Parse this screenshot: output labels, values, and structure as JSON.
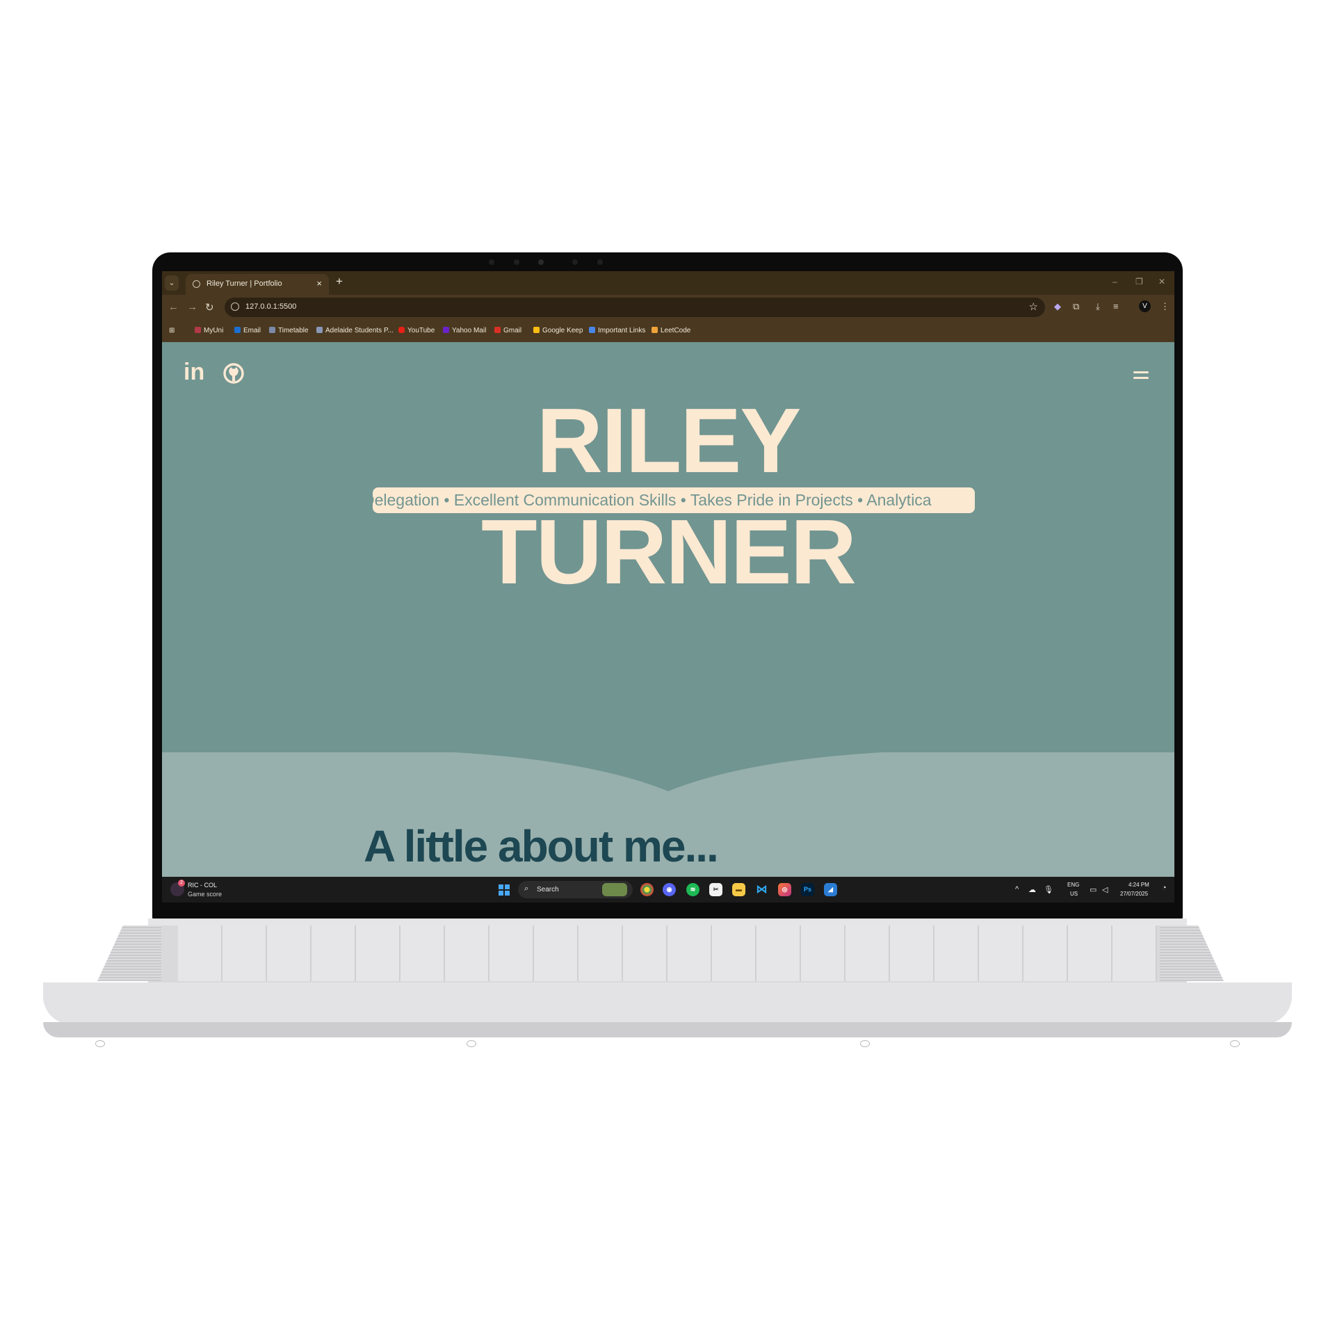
{
  "browser": {
    "tab_title": "Riley Turner | Portfolio",
    "tab_close": "×",
    "new_tab": "+",
    "url": "127.0.0.1:5500",
    "profile_initial": "V",
    "bookmarks": [
      "MyUni",
      "Email",
      "Timetable",
      "Adelaide Students P...",
      "YouTube",
      "Yahoo Mail",
      "Gmail",
      "Google Keep",
      "Important Links",
      "LeetCode"
    ]
  },
  "page": {
    "social": {
      "linkedin": "in",
      "github_icon": "github-icon"
    },
    "hero_first": "RILEY",
    "hero_last": "TURNER",
    "ticker": "Delegation • Excellent Communication Skills • Takes Pride in Projects • Analytica",
    "about_heading": "A little about me...",
    "colors": {
      "background": "#719591",
      "cream": "#fce9d2",
      "lower": "#98b0ad",
      "heading": "#1d4752"
    }
  },
  "taskbar": {
    "widget_badge": "2",
    "widget_title": "RIC - COL",
    "widget_subtitle": "Game score",
    "search_label": "Search",
    "lang_top": "ENG",
    "lang_bottom": "US",
    "time": "4:24 PM",
    "date": "27/07/2025"
  }
}
